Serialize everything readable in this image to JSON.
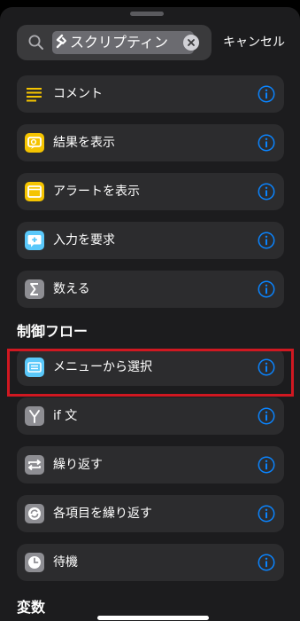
{
  "search": {
    "query": "スクリプティン"
  },
  "cancel_label": "キャンセル",
  "items_top": [
    {
      "label": "コメント",
      "icon": "comment-lines-icon",
      "color": "#f5c400"
    },
    {
      "label": "結果を表示",
      "icon": "show-result-icon",
      "color": "#f5c400"
    },
    {
      "label": "アラートを表示",
      "icon": "alert-window-icon",
      "color": "#f5c400"
    },
    {
      "label": "入力を要求",
      "icon": "ask-input-icon",
      "color": "#5ac8fa"
    },
    {
      "label": "数える",
      "icon": "sigma-icon",
      "color": "#8e8e93"
    }
  ],
  "section_control_flow": "制御フロー",
  "items_control": [
    {
      "label": "メニューから選択",
      "icon": "menu-icon",
      "color": "#5ac8fa"
    },
    {
      "label": "if 文",
      "icon": "branch-icon",
      "color": "#8e8e93"
    },
    {
      "label": "繰り返す",
      "icon": "repeat-icon",
      "color": "#8e8e93"
    },
    {
      "label": "各項目を繰り返す",
      "icon": "repeat-each-icon",
      "color": "#8e8e93"
    },
    {
      "label": "待機",
      "icon": "clock-icon",
      "color": "#8e8e93"
    }
  ],
  "section_variables": "変数",
  "colors": {
    "accent": "#0a84ff",
    "highlight": "#d01821"
  }
}
